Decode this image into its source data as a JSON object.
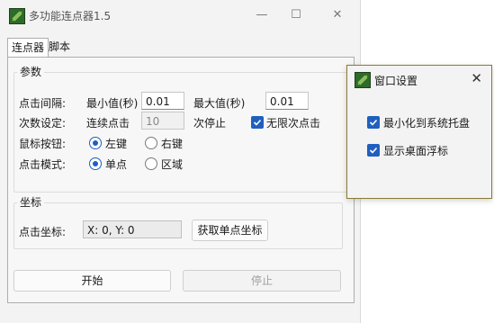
{
  "window": {
    "title": "多功能连点器1.5",
    "minimize_glyph": "—",
    "maximize_glyph": "☐",
    "close_glyph": "✕"
  },
  "tabs": [
    {
      "label": "连点器",
      "active": true
    },
    {
      "label": "脚本",
      "active": false
    }
  ],
  "params": {
    "group_title": "参数",
    "interval_label": "点击间隔:",
    "min_label": "最小值(秒)",
    "min_value": "0.01",
    "max_label": "最大值(秒)",
    "max_value": "0.01",
    "count_label": "次数设定:",
    "continuous_label": "连续点击",
    "count_value": "10",
    "stop_label": "次停止",
    "unlimited_label": "无限次点击",
    "unlimited_checked": true,
    "mouse_label": "鼠标按钮:",
    "left_label": "左键",
    "right_label": "右键",
    "mouse_selected": "left",
    "mode_label": "点击模式:",
    "single_label": "单点",
    "area_label": "区域",
    "mode_selected": "single"
  },
  "coords": {
    "group_title": "坐标",
    "label": "点击坐标:",
    "value": "X: 0, Y: 0",
    "get_button": "获取单点坐标"
  },
  "actions": {
    "start_label": "开始",
    "stop_label": "停止"
  },
  "popup": {
    "title": "窗口设置",
    "close_glyph": "✕",
    "options": [
      {
        "label": "最小化到系统托盘",
        "checked": true
      },
      {
        "label": "显示桌面浮标",
        "checked": true
      }
    ]
  },
  "colors": {
    "accent": "#1f5fbf",
    "popup_border": "#8a7a33",
    "icon_green": "#2e6b2a"
  }
}
